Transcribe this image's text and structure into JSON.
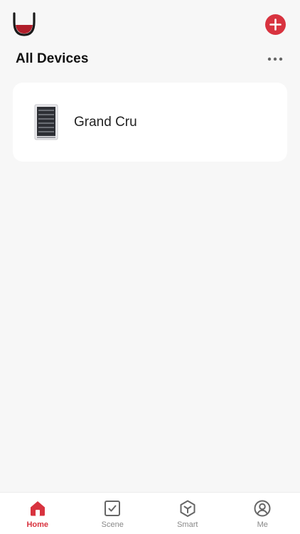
{
  "header": {
    "logo_icon": "wine-glass-icon",
    "add_icon": "plus-icon",
    "title": "All Devices",
    "more_icon": "more-horizontal-icon"
  },
  "devices": [
    {
      "name": "Grand Cru",
      "icon": "wine-cooler-icon"
    }
  ],
  "tabs": [
    {
      "label": "Home",
      "icon": "home-icon",
      "active": true
    },
    {
      "label": "Scene",
      "icon": "checkbox-icon",
      "active": false
    },
    {
      "label": "Smart",
      "icon": "cube-icon",
      "active": false
    },
    {
      "label": "Me",
      "icon": "user-icon",
      "active": false
    }
  ],
  "colors": {
    "accent": "#d8333f",
    "background": "#f7f7f7",
    "card": "#ffffff",
    "inactive_tab": "#888888"
  }
}
